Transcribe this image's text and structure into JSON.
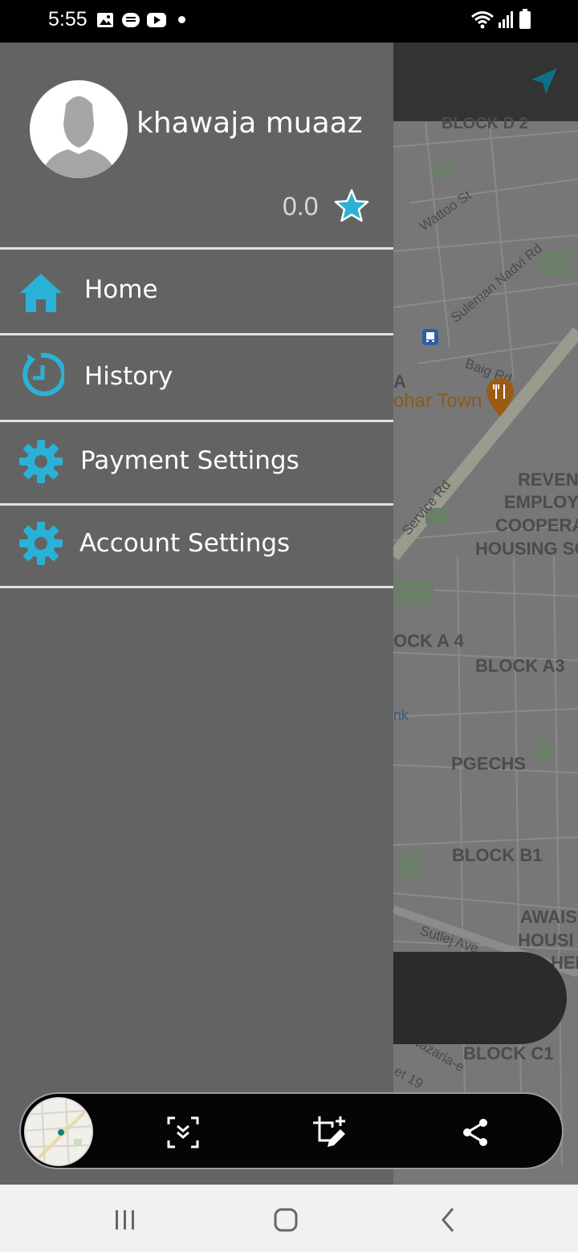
{
  "status_bar": {
    "time": "5:55",
    "left_icons": [
      "image-icon",
      "message-icon",
      "youtube-icon",
      "dot-icon"
    ],
    "right_icons": [
      "wifi-icon",
      "signal-icon",
      "battery-icon"
    ]
  },
  "drawer": {
    "user_name": "khawaja muaaz",
    "rating": "0.0",
    "menu": [
      {
        "label": "Home",
        "icon": "home-icon"
      },
      {
        "label": "History",
        "icon": "history-icon"
      },
      {
        "label": "Payment Settings",
        "icon": "gear-icon"
      },
      {
        "label": "Account Settings",
        "icon": "gear-icon"
      }
    ]
  },
  "map": {
    "labels": [
      "BLOCK D 2",
      "A",
      "ohar Town",
      "REVEN",
      "EMPLOY",
      "COOPERA",
      "HOUSING SC",
      "OCK A 4",
      "BLOCK A3",
      "PGECHS",
      "BLOCK B1",
      "AWAIS",
      "HOUSI",
      "HEM",
      "BLOCK C1",
      "nk"
    ],
    "streets": [
      "Wattoo St",
      "Suleman Nadvi Rd",
      "Baig Rd",
      "Service Rd",
      "Sutlej Ave",
      "Nazaria-e",
      "et 19"
    ]
  },
  "screenshot_toolbar": {
    "buttons": [
      "scroll-capture-icon",
      "edit-crop-icon",
      "share-icon"
    ]
  },
  "nav_bar": {
    "buttons": [
      "recents-icon",
      "home-circle-icon",
      "back-icon"
    ]
  },
  "colors": {
    "accent": "#29b2d6",
    "drawer_bg": "#646364",
    "divider": "#e2e2e2"
  }
}
